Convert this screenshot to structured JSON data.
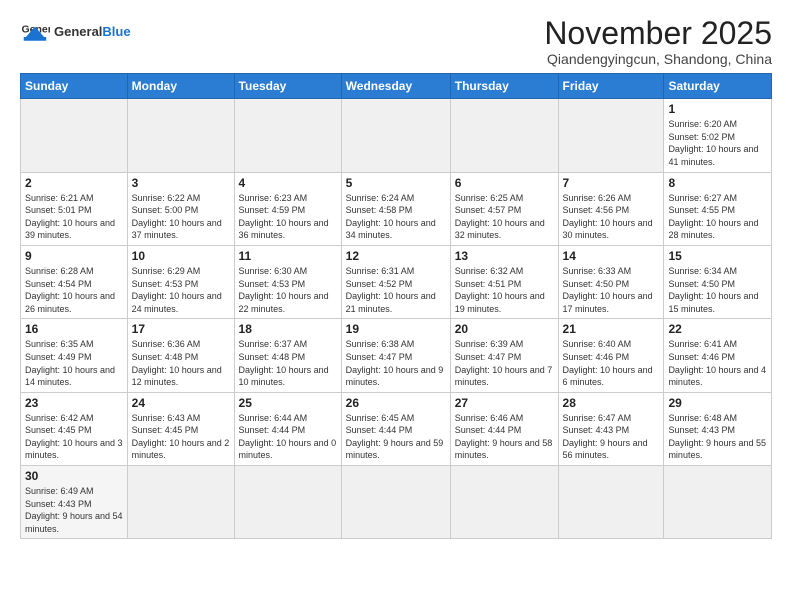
{
  "logo": {
    "text_general": "General",
    "text_blue": "Blue"
  },
  "header": {
    "month": "November 2025",
    "location": "Qiandengyingcun, Shandong, China"
  },
  "weekdays": [
    "Sunday",
    "Monday",
    "Tuesday",
    "Wednesday",
    "Thursday",
    "Friday",
    "Saturday"
  ],
  "weeks": [
    [
      {
        "day": "",
        "info": ""
      },
      {
        "day": "",
        "info": ""
      },
      {
        "day": "",
        "info": ""
      },
      {
        "day": "",
        "info": ""
      },
      {
        "day": "",
        "info": ""
      },
      {
        "day": "",
        "info": ""
      },
      {
        "day": "1",
        "info": "Sunrise: 6:20 AM\nSunset: 5:02 PM\nDaylight: 10 hours and 41 minutes."
      }
    ],
    [
      {
        "day": "2",
        "info": "Sunrise: 6:21 AM\nSunset: 5:01 PM\nDaylight: 10 hours and 39 minutes."
      },
      {
        "day": "3",
        "info": "Sunrise: 6:22 AM\nSunset: 5:00 PM\nDaylight: 10 hours and 37 minutes."
      },
      {
        "day": "4",
        "info": "Sunrise: 6:23 AM\nSunset: 4:59 PM\nDaylight: 10 hours and 36 minutes."
      },
      {
        "day": "5",
        "info": "Sunrise: 6:24 AM\nSunset: 4:58 PM\nDaylight: 10 hours and 34 minutes."
      },
      {
        "day": "6",
        "info": "Sunrise: 6:25 AM\nSunset: 4:57 PM\nDaylight: 10 hours and 32 minutes."
      },
      {
        "day": "7",
        "info": "Sunrise: 6:26 AM\nSunset: 4:56 PM\nDaylight: 10 hours and 30 minutes."
      },
      {
        "day": "8",
        "info": "Sunrise: 6:27 AM\nSunset: 4:55 PM\nDaylight: 10 hours and 28 minutes."
      }
    ],
    [
      {
        "day": "9",
        "info": "Sunrise: 6:28 AM\nSunset: 4:54 PM\nDaylight: 10 hours and 26 minutes."
      },
      {
        "day": "10",
        "info": "Sunrise: 6:29 AM\nSunset: 4:53 PM\nDaylight: 10 hours and 24 minutes."
      },
      {
        "day": "11",
        "info": "Sunrise: 6:30 AM\nSunset: 4:53 PM\nDaylight: 10 hours and 22 minutes."
      },
      {
        "day": "12",
        "info": "Sunrise: 6:31 AM\nSunset: 4:52 PM\nDaylight: 10 hours and 21 minutes."
      },
      {
        "day": "13",
        "info": "Sunrise: 6:32 AM\nSunset: 4:51 PM\nDaylight: 10 hours and 19 minutes."
      },
      {
        "day": "14",
        "info": "Sunrise: 6:33 AM\nSunset: 4:50 PM\nDaylight: 10 hours and 17 minutes."
      },
      {
        "day": "15",
        "info": "Sunrise: 6:34 AM\nSunset: 4:50 PM\nDaylight: 10 hours and 15 minutes."
      }
    ],
    [
      {
        "day": "16",
        "info": "Sunrise: 6:35 AM\nSunset: 4:49 PM\nDaylight: 10 hours and 14 minutes."
      },
      {
        "day": "17",
        "info": "Sunrise: 6:36 AM\nSunset: 4:48 PM\nDaylight: 10 hours and 12 minutes."
      },
      {
        "day": "18",
        "info": "Sunrise: 6:37 AM\nSunset: 4:48 PM\nDaylight: 10 hours and 10 minutes."
      },
      {
        "day": "19",
        "info": "Sunrise: 6:38 AM\nSunset: 4:47 PM\nDaylight: 10 hours and 9 minutes."
      },
      {
        "day": "20",
        "info": "Sunrise: 6:39 AM\nSunset: 4:47 PM\nDaylight: 10 hours and 7 minutes."
      },
      {
        "day": "21",
        "info": "Sunrise: 6:40 AM\nSunset: 4:46 PM\nDaylight: 10 hours and 6 minutes."
      },
      {
        "day": "22",
        "info": "Sunrise: 6:41 AM\nSunset: 4:46 PM\nDaylight: 10 hours and 4 minutes."
      }
    ],
    [
      {
        "day": "23",
        "info": "Sunrise: 6:42 AM\nSunset: 4:45 PM\nDaylight: 10 hours and 3 minutes."
      },
      {
        "day": "24",
        "info": "Sunrise: 6:43 AM\nSunset: 4:45 PM\nDaylight: 10 hours and 2 minutes."
      },
      {
        "day": "25",
        "info": "Sunrise: 6:44 AM\nSunset: 4:44 PM\nDaylight: 10 hours and 0 minutes."
      },
      {
        "day": "26",
        "info": "Sunrise: 6:45 AM\nSunset: 4:44 PM\nDaylight: 9 hours and 59 minutes."
      },
      {
        "day": "27",
        "info": "Sunrise: 6:46 AM\nSunset: 4:44 PM\nDaylight: 9 hours and 58 minutes."
      },
      {
        "day": "28",
        "info": "Sunrise: 6:47 AM\nSunset: 4:43 PM\nDaylight: 9 hours and 56 minutes."
      },
      {
        "day": "29",
        "info": "Sunrise: 6:48 AM\nSunset: 4:43 PM\nDaylight: 9 hours and 55 minutes."
      }
    ],
    [
      {
        "day": "30",
        "info": "Sunrise: 6:49 AM\nSunset: 4:43 PM\nDaylight: 9 hours and 54 minutes."
      },
      {
        "day": "",
        "info": ""
      },
      {
        "day": "",
        "info": ""
      },
      {
        "day": "",
        "info": ""
      },
      {
        "day": "",
        "info": ""
      },
      {
        "day": "",
        "info": ""
      },
      {
        "day": "",
        "info": ""
      }
    ]
  ]
}
